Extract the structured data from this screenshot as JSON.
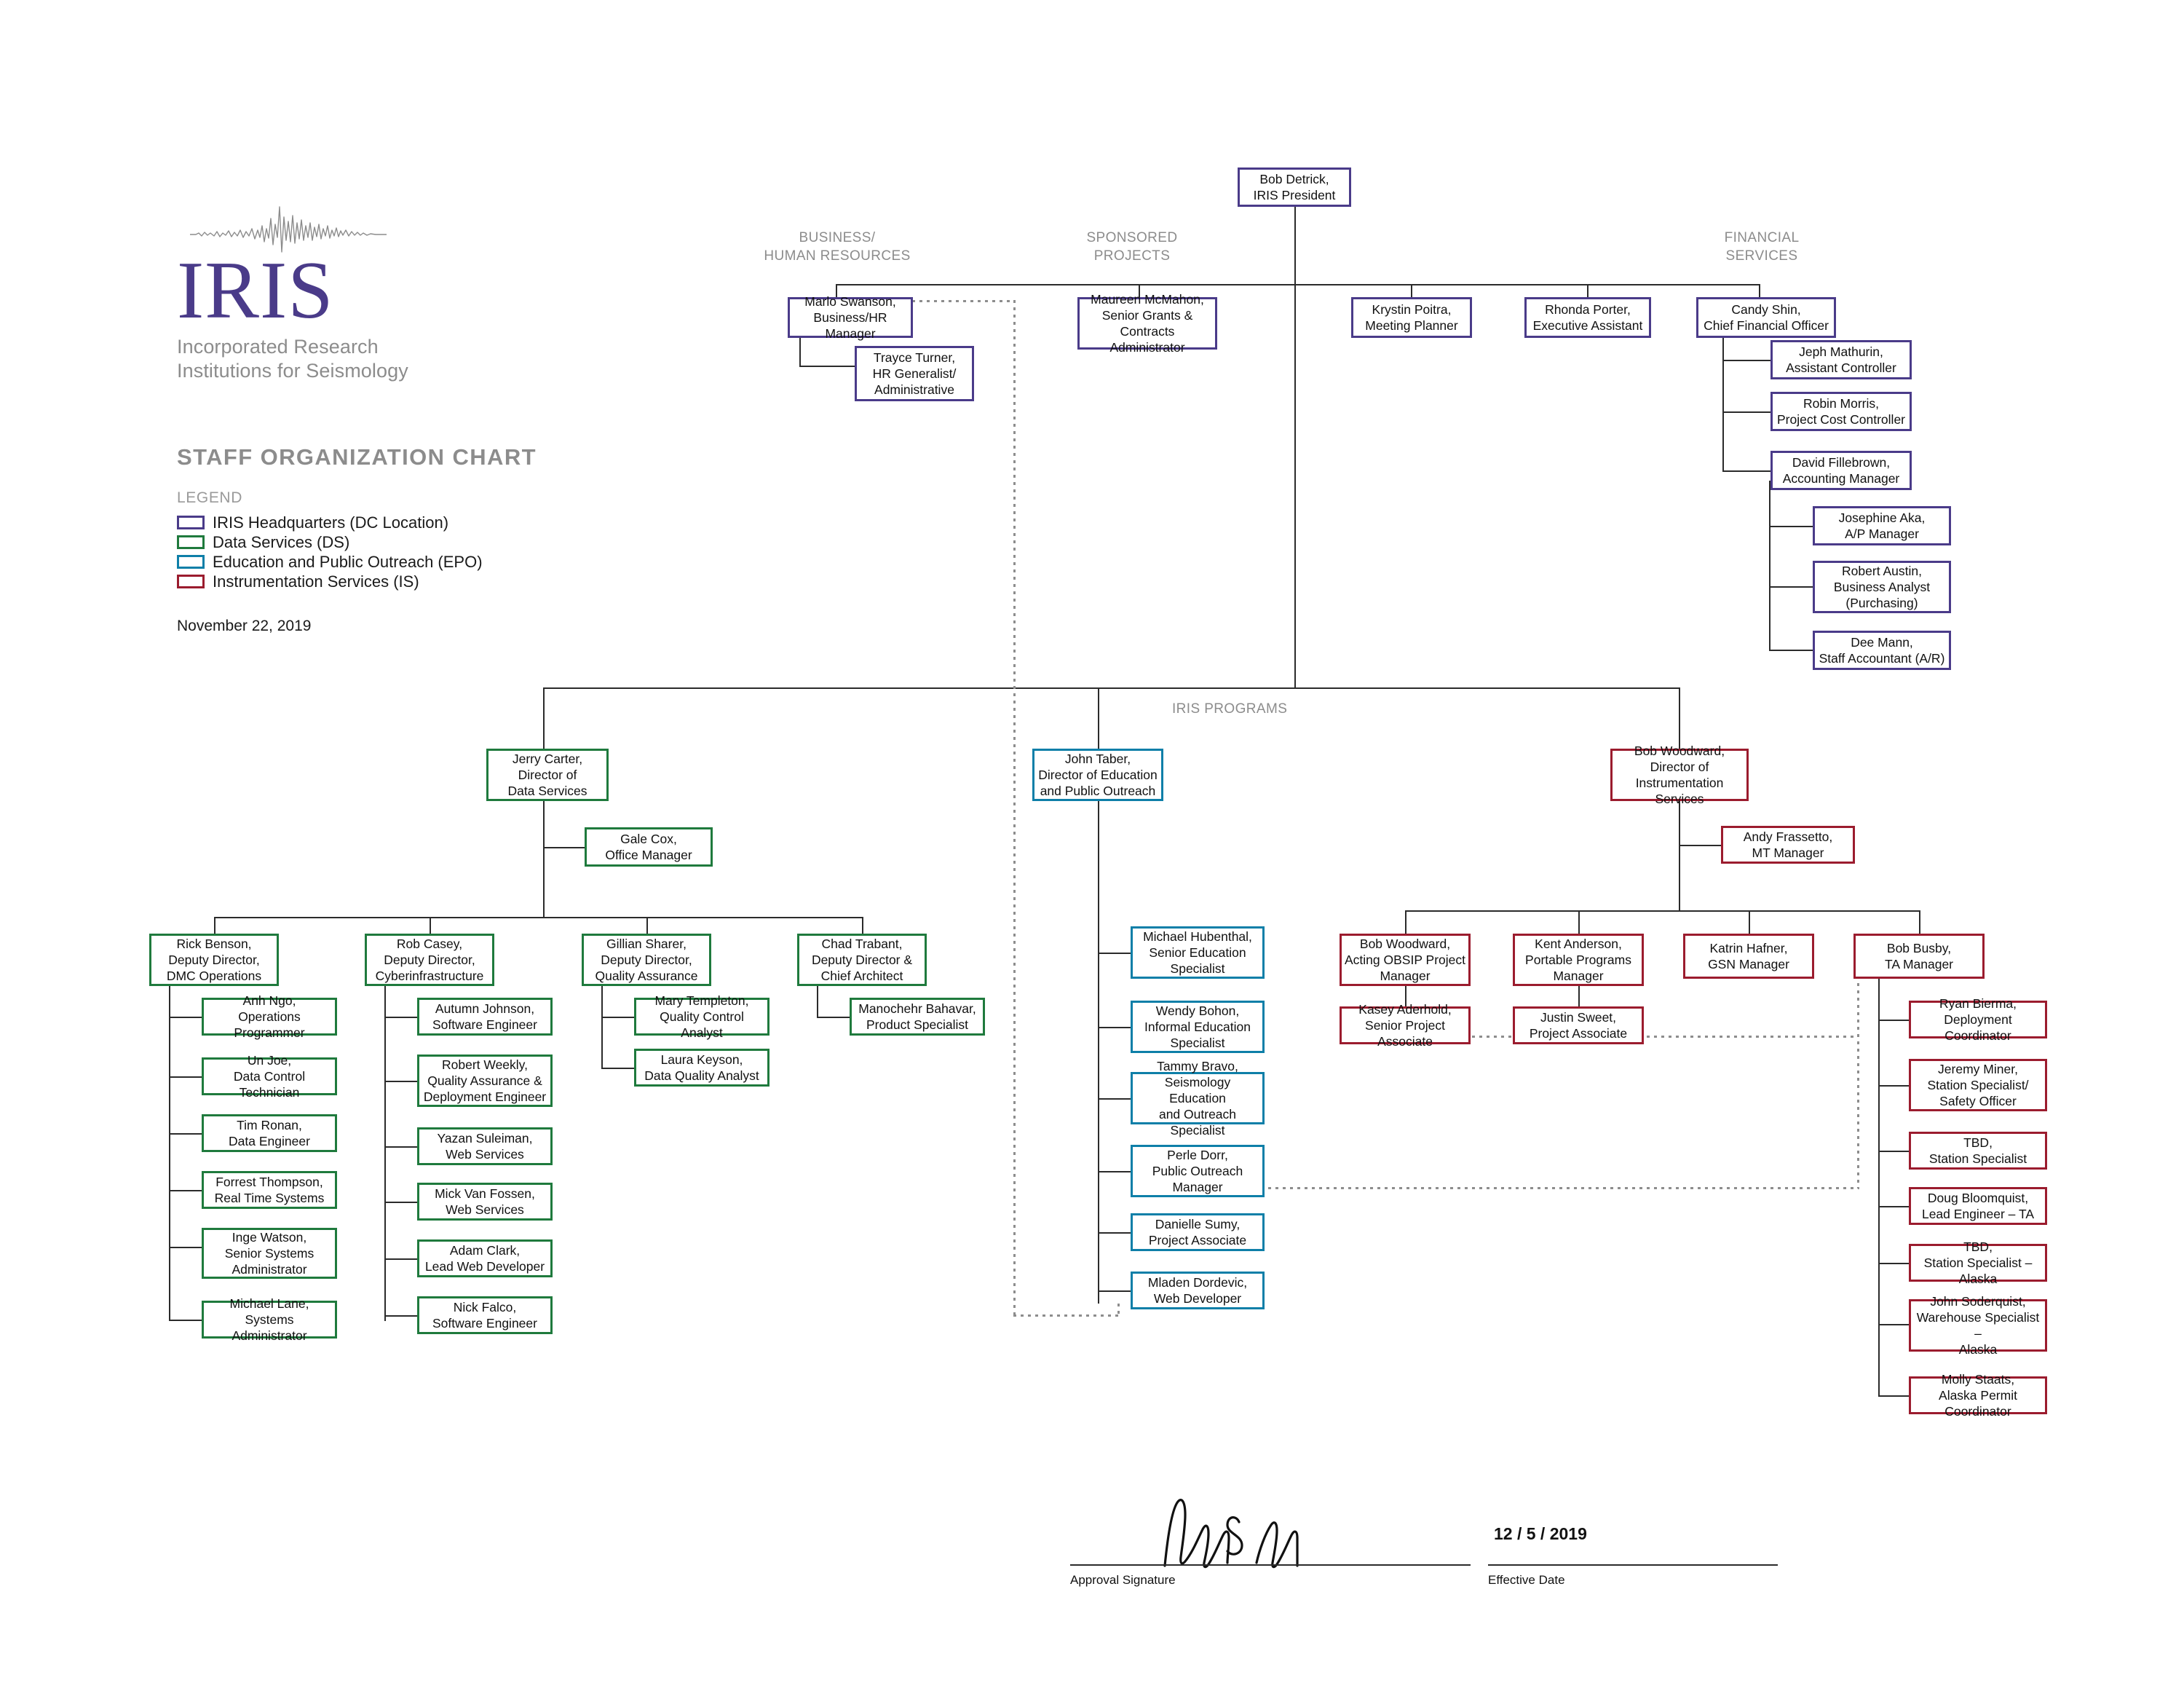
{
  "logo": {
    "wordmark": "IRIS",
    "tagline_line1": "Incorporated Research",
    "tagline_line2": "Institutions for Seismology"
  },
  "title": "STAFF ORGANIZATION CHART",
  "legend": {
    "heading": "LEGEND",
    "items": [
      {
        "label": "IRIS Headquarters (DC Location)",
        "color": "#4a3b89"
      },
      {
        "label": "Data Services (DS)",
        "color": "#1f7a3d"
      },
      {
        "label": "Education and Public Outreach (EPO)",
        "color": "#0e7fa8"
      },
      {
        "label": "Instrumentation Services (IS)",
        "color": "#9b1c2e"
      }
    ]
  },
  "doc_date": "November 22, 2019",
  "group_labels": {
    "business_hr": "BUSINESS/\nHUMAN RESOURCES",
    "business_hr_l1": "BUSINESS/",
    "business_hr_l2": "HUMAN RESOURCES",
    "sponsored_l1": "SPONSORED",
    "sponsored_l2": "PROJECTS",
    "financial_l1": "FINANCIAL",
    "financial_l2": "SERVICES",
    "iris_programs": "IRIS PROGRAMS"
  },
  "nodes": {
    "president": {
      "name": "Bob Detrick,",
      "role": "IRIS President",
      "unit": "hq"
    },
    "marlo": {
      "name": "Marlo Swanson,",
      "role": "Business/HR Manager",
      "unit": "hq"
    },
    "trayce": {
      "name": "Trayce Turner,",
      "role": "HR Generalist/",
      "role2": "Administrative",
      "unit": "hq"
    },
    "maureen": {
      "name": "Maureen McMahon,",
      "role": "Senior Grants &",
      "role2": "Contracts Administrator",
      "unit": "hq"
    },
    "krystin": {
      "name": "Krystin Poitra,",
      "role": "Meeting Planner",
      "unit": "hq"
    },
    "rhonda": {
      "name": "Rhonda Porter,",
      "role": "Executive  Assistant",
      "unit": "hq"
    },
    "candy": {
      "name": "Candy Shin,",
      "role": "Chief Financial Officer",
      "unit": "hq"
    },
    "jeph": {
      "name": "Jeph Mathurin,",
      "role": "Assistant Controller",
      "unit": "hq"
    },
    "robinm": {
      "name": "Robin Morris,",
      "role": "Project Cost Controller",
      "unit": "hq"
    },
    "davidf": {
      "name": "David Fillebrown,",
      "role": "Accounting Manager",
      "unit": "hq"
    },
    "josephine": {
      "name": "Josephine Aka,",
      "role": "A/P Manager",
      "unit": "hq"
    },
    "roberta": {
      "name": "Robert Austin,",
      "role": "Business Analyst",
      "role2": "(Purchasing)",
      "unit": "hq"
    },
    "deemann": {
      "name": "Dee Mann,",
      "role": "Staff Accountant (A/R)",
      "unit": "hq"
    },
    "jerry": {
      "name": "Jerry Carter,",
      "role": "Director of",
      "role2": "Data Services",
      "unit": "ds"
    },
    "gale": {
      "name": "Gale Cox,",
      "role": "Office Manager",
      "unit": "ds"
    },
    "rick": {
      "name": "Rick Benson,",
      "role": "Deputy Director,",
      "role2": "DMC Operations",
      "unit": "ds"
    },
    "anh": {
      "name": "Anh Ngo,",
      "role": "Operations Programmer",
      "unit": "ds"
    },
    "unjoe": {
      "name": "Un Joe,",
      "role": "Data Control Technician",
      "unit": "ds"
    },
    "timr": {
      "name": "Tim Ronan,",
      "role": "Data Engineer",
      "unit": "ds"
    },
    "forrest": {
      "name": "Forrest Thompson,",
      "role": "Real Time Systems",
      "unit": "ds"
    },
    "inge": {
      "name": "Inge Watson,",
      "role": "Senior Systems",
      "role2": "Administrator",
      "unit": "ds"
    },
    "michaell": {
      "name": "Michael Lane,",
      "role": "Systems Administrator",
      "unit": "ds"
    },
    "rob": {
      "name": "Rob Casey,",
      "role": "Deputy Director,",
      "role2": "Cyberinfrastructure",
      "unit": "ds"
    },
    "autumn": {
      "name": "Autumn Johnson,",
      "role": "Software Engineer",
      "unit": "ds"
    },
    "robertw": {
      "name": "Robert Weekly,",
      "role": "Quality Assurance &",
      "role2": "Deployment Engineer",
      "unit": "ds"
    },
    "yazan": {
      "name": "Yazan Suleiman,",
      "role": "Web Services",
      "unit": "ds"
    },
    "mick": {
      "name": "Mick Van Fossen,",
      "role": "Web Services",
      "unit": "ds"
    },
    "adam": {
      "name": "Adam Clark,",
      "role": "Lead Web Developer",
      "unit": "ds"
    },
    "nick": {
      "name": "Nick Falco,",
      "role": "Software Engineer",
      "unit": "ds"
    },
    "gillian": {
      "name": "Gillian Sharer,",
      "role": "Deputy Director,",
      "role2": "Quality Assurance",
      "unit": "ds"
    },
    "mary": {
      "name": "Mary Templeton,",
      "role": "Quality Control Analyst",
      "unit": "ds"
    },
    "laura": {
      "name": "Laura Keyson,",
      "role": "Data Quality Analyst",
      "unit": "ds"
    },
    "chad": {
      "name": "Chad Trabant,",
      "role": "Deputy Director &",
      "role2": "Chief Architect",
      "unit": "ds"
    },
    "manochehr": {
      "name": "Manochehr Bahavar,",
      "role": "Product Specialist",
      "unit": "ds"
    },
    "johntaber": {
      "name": "John Taber,",
      "role": "Director of Education",
      "role2": "and Public Outreach",
      "unit": "epo"
    },
    "hubenthal": {
      "name": "Michael Hubenthal,",
      "role": "Senior Education",
      "role2": "Specialist",
      "unit": "epo"
    },
    "wendy": {
      "name": "Wendy Bohon,",
      "role": "Informal Education",
      "role2": "Specialist",
      "unit": "epo"
    },
    "tammy": {
      "name": "Tammy Bravo,",
      "role": "Seismology Education",
      "role2": "and Outreach Specialist",
      "unit": "epo"
    },
    "perle": {
      "name": "Perle Dorr,",
      "role": "Public Outreach",
      "role2": "Manager",
      "unit": "epo"
    },
    "danielle": {
      "name": "Danielle Sumy,",
      "role": "Project Associate",
      "unit": "epo"
    },
    "mladen": {
      "name": "Mladen Dordevic,",
      "role": "Web Developer",
      "unit": "epo"
    },
    "bobw": {
      "name": "Bob Woodward,",
      "role": "Director of",
      "role2": "Instrumentation Services",
      "unit": "is"
    },
    "andy": {
      "name": "Andy Frassetto,",
      "role": "MT Manager",
      "unit": "is"
    },
    "bobw2": {
      "name": "Bob Woodward,",
      "role": "Acting OBSIP Project",
      "role2": "Manager",
      "unit": "is"
    },
    "kasey": {
      "name": "Kasey Aderhold,",
      "role": "Senior Project Associate",
      "unit": "is"
    },
    "kent": {
      "name": "Kent Anderson,",
      "role": "Portable Programs",
      "role2": "Manager",
      "unit": "is"
    },
    "justin": {
      "name": "Justin Sweet,",
      "role": "Project Associate",
      "unit": "is"
    },
    "katrin": {
      "name": "Katrin Hafner,",
      "role": "GSN Manager",
      "unit": "is"
    },
    "bobbusby": {
      "name": "Bob Busby,",
      "role": "TA Manager",
      "unit": "is"
    },
    "ryan": {
      "name": "Ryan Bierma,",
      "role": "Deployment Coordinator",
      "unit": "is"
    },
    "jeremy": {
      "name": "Jeremy Miner,",
      "role": "Station Specialist/",
      "role2": "Safety Officer",
      "unit": "is"
    },
    "tbd1": {
      "name": "TBD,",
      "role": "Station Specialist",
      "unit": "is"
    },
    "doug": {
      "name": "Doug Bloomquist,",
      "role": "Lead Engineer – TA",
      "unit": "is"
    },
    "tbd2": {
      "name": "TBD,",
      "role": "Station Specialist – Alaska",
      "unit": "is"
    },
    "johns": {
      "name": "John Soderquist,",
      "role": "Warehouse Specialist –",
      "role2": "Alaska",
      "unit": "is"
    },
    "molly": {
      "name": "Molly Staats,",
      "role": "Alaska Permit Coordinator",
      "unit": "is"
    }
  },
  "footer": {
    "approval_caption": "Approval Signature",
    "effective_caption": "Effective Date",
    "effective_date": "12 / 5 / 2019"
  }
}
